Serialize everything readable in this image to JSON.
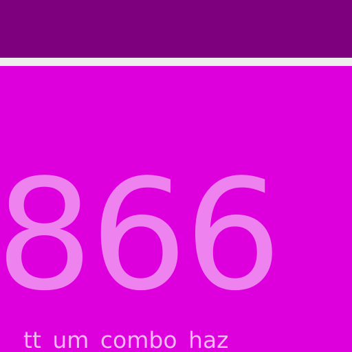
{
  "colors": {
    "top_bar": "#7f007f",
    "divider": "#eeeeee",
    "background": "#dd00dd",
    "number_text": "#ee82ee",
    "caption_text": "#f0b8f0"
  },
  "main": {
    "value": "866",
    "caption": "tt um combo haz"
  }
}
